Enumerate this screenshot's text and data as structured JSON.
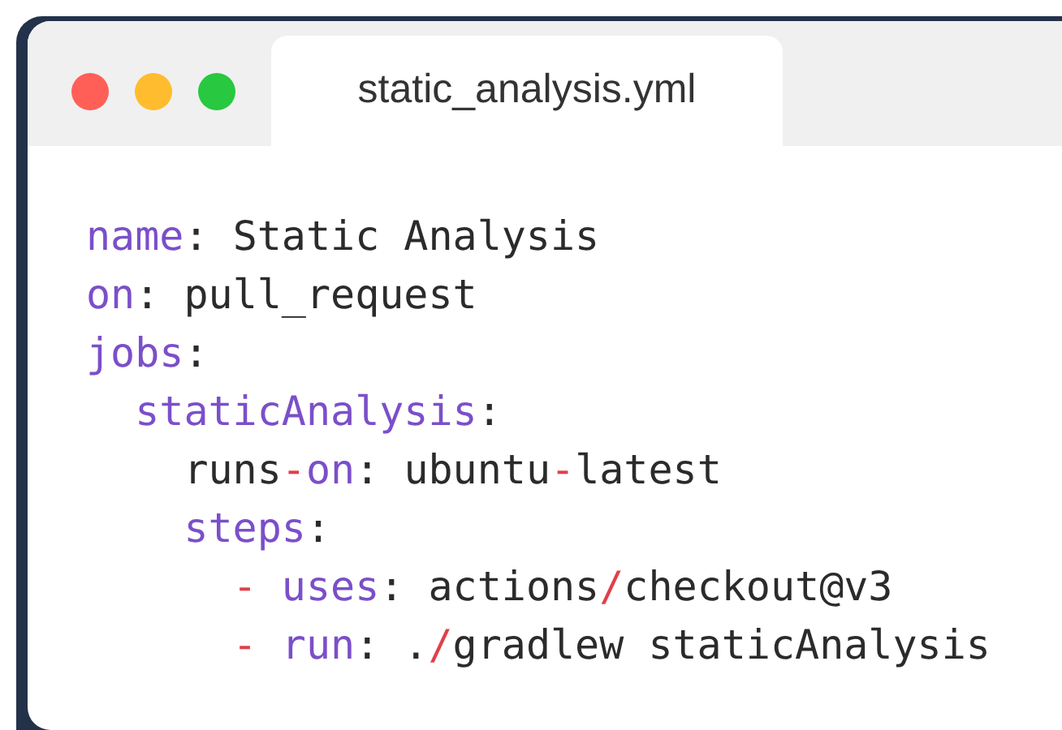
{
  "window_controls": [
    {
      "color": "#ff5f57"
    },
    {
      "color": "#febc2e"
    },
    {
      "color": "#28c840"
    }
  ],
  "tabs": [
    {
      "label": "static_analysis.yml",
      "selected": true
    }
  ],
  "code_lines": [
    {
      "tokens": [
        {
          "text": "name",
          "kind": "key"
        },
        {
          "text": ": Static Analysis",
          "kind": "plain"
        }
      ]
    },
    {
      "tokens": [
        {
          "text": "on",
          "kind": "key"
        },
        {
          "text": ": pull_request",
          "kind": "plain"
        }
      ]
    },
    {
      "tokens": [
        {
          "text": "jobs",
          "kind": "key"
        },
        {
          "text": ":",
          "kind": "plain"
        }
      ]
    },
    {
      "tokens": [
        {
          "text": "  staticAnalysis",
          "kind": "key"
        },
        {
          "text": ":",
          "kind": "plain"
        }
      ]
    },
    {
      "tokens": [
        {
          "text": "    runs",
          "kind": "plain"
        },
        {
          "text": "-",
          "kind": "operator"
        },
        {
          "text": "on",
          "kind": "key"
        },
        {
          "text": ": ubuntu",
          "kind": "plain"
        },
        {
          "text": "-",
          "kind": "operator"
        },
        {
          "text": "latest",
          "kind": "plain"
        }
      ]
    },
    {
      "tokens": [
        {
          "text": "    steps",
          "kind": "key"
        },
        {
          "text": ":",
          "kind": "plain"
        }
      ]
    },
    {
      "tokens": [
        {
          "text": "      - ",
          "kind": "operator"
        },
        {
          "text": "uses",
          "kind": "key"
        },
        {
          "text": ": actions",
          "kind": "plain"
        },
        {
          "text": "/",
          "kind": "operator"
        },
        {
          "text": "checkout@v3",
          "kind": "plain"
        }
      ]
    },
    {
      "tokens": [
        {
          "text": "      - ",
          "kind": "operator"
        },
        {
          "text": "run",
          "kind": "key"
        },
        {
          "text": ": .",
          "kind": "plain"
        },
        {
          "text": "/",
          "kind": "operator"
        },
        {
          "text": "gradlew staticAnalysis",
          "kind": "plain"
        }
      ]
    }
  ]
}
